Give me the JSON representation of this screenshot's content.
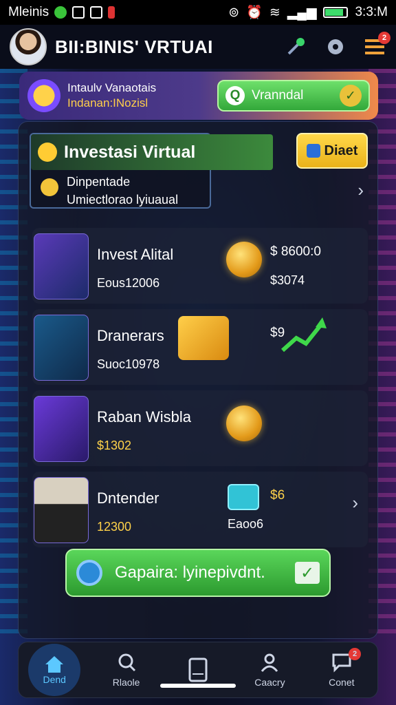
{
  "status_bar": {
    "carrier": "Mleinis",
    "time": "3:3:M"
  },
  "header": {
    "title": "BII:BINIS' VRTUAI",
    "notification_count": "2"
  },
  "promo": {
    "line1": "Intaulv Vanaotais",
    "line2": "Indanan:INozisl",
    "button_label": "Vranndal"
  },
  "hero": {
    "title": "Investasi Virtual",
    "line1": "Dinpentade",
    "line2": "Umiectlorao lyiuaual",
    "side_button": "Diaet"
  },
  "items": [
    {
      "name": "Invest Alital",
      "sub": "Eous12006",
      "value": "$ 8600:0",
      "value2": "$3074"
    },
    {
      "name": "Dranerars",
      "sub": "Suoc10978",
      "value": "$9",
      "value2": ""
    },
    {
      "name": "Raban Wisbla",
      "sub": "$1302",
      "value": "",
      "value2": ""
    },
    {
      "name": "Dntender",
      "sub": "12300",
      "value": "$6",
      "value2": "Eaoo6"
    }
  ],
  "cta": {
    "label": "Gapaira: lyinepivdnt."
  },
  "bottom_nav": {
    "items": [
      {
        "label": "Dend",
        "icon": "home-icon"
      },
      {
        "label": "Rlaole",
        "icon": "search-icon"
      },
      {
        "label": "",
        "icon": "tablet-icon"
      },
      {
        "label": "Caacry",
        "icon": "person-icon"
      },
      {
        "label": "Conet",
        "icon": "chat-icon",
        "badge": "2"
      }
    ]
  },
  "colors": {
    "accent_green": "#3fb644",
    "accent_yellow": "#f2c43a",
    "accent_blue": "#5cc8ff"
  }
}
